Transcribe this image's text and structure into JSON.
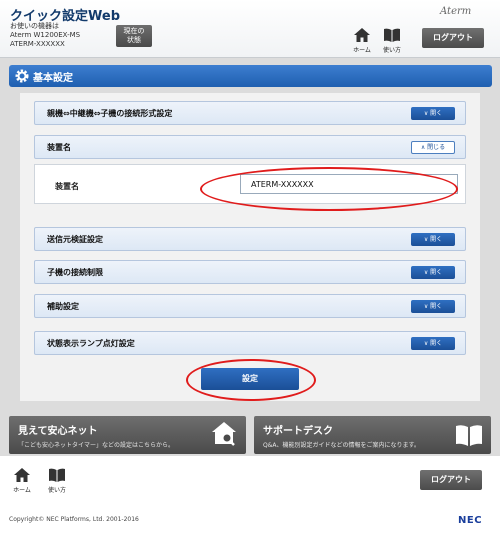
{
  "header": {
    "app_title": "クイック設定Web",
    "device_lines": [
      "お使いの機器は",
      "Aterm W1200EX-MS",
      "ATERM-XXXXXX"
    ],
    "status_button": "現在の\n状態",
    "brand": "Aterm",
    "home_label": "ホーム",
    "help_label": "使い方",
    "logout": "ログアウト"
  },
  "section": {
    "title": "基本設定"
  },
  "accordions": [
    {
      "title": "親機⇔中継機⇔子機の接続形式設定",
      "button": "開く"
    },
    {
      "title": "装置名",
      "button": "閉じる"
    },
    {
      "title": "送信元検証設定",
      "button": "開く"
    },
    {
      "title": "子機の接続制限",
      "button": "開く"
    },
    {
      "title": "補助設定",
      "button": "開く"
    },
    {
      "title": "状態表示ランプ点灯設定",
      "button": "開く"
    }
  ],
  "device_name_field": {
    "label": "装置名",
    "value": "ATERM-XXXXXX"
  },
  "submit": "設定",
  "cards": [
    {
      "title": "見えて安心ネット",
      "desc": "「こども安心ネットタイマー」などの設定はこちらから。"
    },
    {
      "title": "サポートデスク",
      "desc": "Q&A、機能別設定ガイドなどの情報をご案内になります。"
    }
  ],
  "footer": {
    "home_label": "ホーム",
    "help_label": "使い方",
    "logout": "ログアウト",
    "copyright": "Copyright© NEC Platforms, Ltd. 2001-2016",
    "logo": "NEC"
  },
  "colors": {
    "accent_blue": "#1f5fb0",
    "highlight_red": "#e01c1c",
    "dark_button": "#4b4b4b"
  }
}
